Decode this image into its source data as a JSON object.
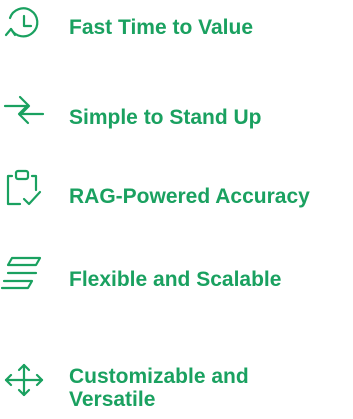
{
  "accent_color": "#1aa160",
  "features": [
    {
      "icon": "clock-icon",
      "label": "Fast Time to Value"
    },
    {
      "icon": "opposing-arrows-icon",
      "label": "Simple to Stand Up"
    },
    {
      "icon": "clipboard-check-icon",
      "label": "RAG-Powered Accuracy"
    },
    {
      "icon": "stacked-layers-icon",
      "label": "Flexible and Scalable"
    },
    {
      "icon": "move-arrows-icon",
      "label": "Customizable and Versatile"
    }
  ]
}
